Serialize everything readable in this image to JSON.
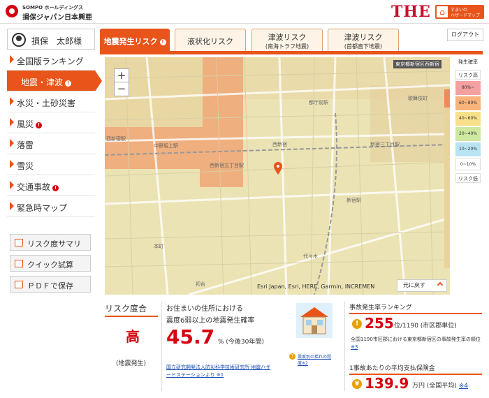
{
  "header": {
    "company_small": "SOMPO ホールディングス",
    "company_name": "損保ジャパン日本興亜",
    "brand": "THE",
    "brand_sub1": "すまいの",
    "brand_sub2": "ハザードマップ"
  },
  "user": {
    "name": "損保　太郎様"
  },
  "sidebar": {
    "items": [
      {
        "label": "全国版ランキング",
        "badge": false
      },
      {
        "label": "地震・津波",
        "badge": true,
        "active": true
      },
      {
        "label": "水災・土砂災害",
        "badge": false
      },
      {
        "label": "風災",
        "badge": true
      },
      {
        "label": "落雷",
        "badge": false
      },
      {
        "label": "雪災",
        "badge": false
      },
      {
        "label": "交通事故",
        "badge": true
      },
      {
        "label": "緊急時マップ",
        "badge": false
      }
    ],
    "buttons": [
      {
        "label": "リスク度サマリ"
      },
      {
        "label": "クイック試算"
      },
      {
        "label": "ＰＤＦで保存"
      }
    ]
  },
  "tabs": [
    {
      "label": "地震発生リスク",
      "sub": "",
      "active": true
    },
    {
      "label": "液状化リスク",
      "sub": ""
    },
    {
      "label": "津波リスク",
      "sub": "(南海トラフ地震)"
    },
    {
      "label": "津波リスク",
      "sub": "(首都直下地震)"
    }
  ],
  "logout_label": "ログアウト",
  "map": {
    "area_tag": "東京都新宿区西新宿",
    "attribution": "Esri Japan, Esri, HERE, Garmin, INCREMEN",
    "reset_label": "元に戻す",
    "zoom_in": "+",
    "zoom_out": "−",
    "labels": [
      "西新宿五丁目駅",
      "都庁前駅",
      "西新宿駅",
      "歌舞伎町",
      "新宿駅",
      "代々木",
      "本町",
      "中野坂上駅",
      "新宿三丁目駅",
      "初台",
      "西新宿"
    ]
  },
  "legend": {
    "title": "発生確率",
    "top": "リスク高",
    "bottom": "リスク低",
    "ranges": [
      "80%~",
      "60~80%",
      "40~60%",
      "20~40%",
      "10~20%",
      "0~10%"
    ],
    "colors": [
      "#f4a0a0",
      "#f7b37a",
      "#f8e08a",
      "#cfe8a0",
      "#b7e3f2",
      "#ffffff"
    ]
  },
  "risk": {
    "title": "リスク度合",
    "level": "高",
    "kind": "(地震発生)"
  },
  "probability": {
    "line1": "お住まいの住所における",
    "line2": "震度6弱以上の地震発生確率",
    "value": "45.7",
    "unit": "% (今後30年間)",
    "note": "国立研究開発法人防災科学技術研究所 地震ハザードステーションより ※1"
  },
  "house_caption": "震度別の揺れの程度※2",
  "ranking": {
    "title": "事故発生率ランキング",
    "value": "255",
    "rest": "位/1190 (市区郡単位)",
    "desc": "全国1190市区郡における東京都新宿区の事故発生率の順位",
    "desc_link": "※3"
  },
  "premium": {
    "title": "1事故あたりの平均支払保険金",
    "value": "139.9",
    "rest": "万円 (全国平均)",
    "link": "※4"
  }
}
